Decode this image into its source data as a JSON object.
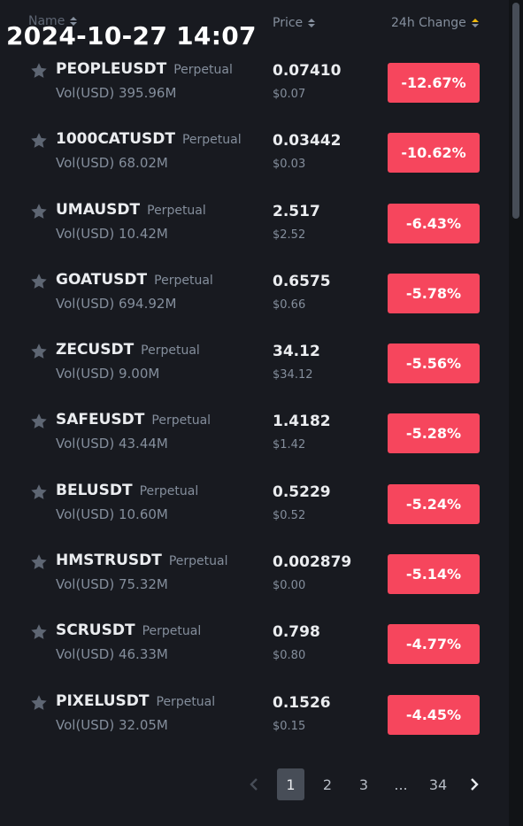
{
  "timestamp": "2024-10-27 14:07",
  "header": {
    "name_label": "Name",
    "price_label": "Price",
    "change_label": "24h Change"
  },
  "rows": [
    {
      "symbol": "PEOPLEUSDT",
      "type": "Perpetual",
      "vol": "Vol(USD) 395.96M",
      "price": "0.07410",
      "usd": "$0.07",
      "change": "-12.67%"
    },
    {
      "symbol": "1000CATUSDT",
      "type": "Perpetual",
      "vol": "Vol(USD) 68.02M",
      "price": "0.03442",
      "usd": "$0.03",
      "change": "-10.62%"
    },
    {
      "symbol": "UMAUSDT",
      "type": "Perpetual",
      "vol": "Vol(USD) 10.42M",
      "price": "2.517",
      "usd": "$2.52",
      "change": "-6.43%"
    },
    {
      "symbol": "GOATUSDT",
      "type": "Perpetual",
      "vol": "Vol(USD) 694.92M",
      "price": "0.6575",
      "usd": "$0.66",
      "change": "-5.78%"
    },
    {
      "symbol": "ZECUSDT",
      "type": "Perpetual",
      "vol": "Vol(USD) 9.00M",
      "price": "34.12",
      "usd": "$34.12",
      "change": "-5.56%"
    },
    {
      "symbol": "SAFEUSDT",
      "type": "Perpetual",
      "vol": "Vol(USD) 43.44M",
      "price": "1.4182",
      "usd": "$1.42",
      "change": "-5.28%"
    },
    {
      "symbol": "BELUSDT",
      "type": "Perpetual",
      "vol": "Vol(USD) 10.60M",
      "price": "0.5229",
      "usd": "$0.52",
      "change": "-5.24%"
    },
    {
      "symbol": "HMSTRUSDT",
      "type": "Perpetual",
      "vol": "Vol(USD) 75.32M",
      "price": "0.002879",
      "usd": "$0.00",
      "change": "-5.14%"
    },
    {
      "symbol": "SCRUSDT",
      "type": "Perpetual",
      "vol": "Vol(USD) 46.33M",
      "price": "0.798",
      "usd": "$0.80",
      "change": "-4.77%"
    },
    {
      "symbol": "PIXELUSDT",
      "type": "Perpetual",
      "vol": "Vol(USD) 32.05M",
      "price": "0.1526",
      "usd": "$0.15",
      "change": "-4.45%"
    }
  ],
  "pagination": {
    "pages": [
      "1",
      "2",
      "3",
      "...",
      "34"
    ],
    "current": "1"
  },
  "colors": {
    "background": "#181a20",
    "negative": "#f6465d",
    "sort_active": "#f0b90b",
    "muted_text": "#848e9c",
    "primary_text": "#eaecef"
  },
  "icons": {
    "favorite": "star-icon",
    "prev": "chevron-left-icon",
    "next": "chevron-right-icon",
    "sort": "sort-arrows-icon"
  }
}
